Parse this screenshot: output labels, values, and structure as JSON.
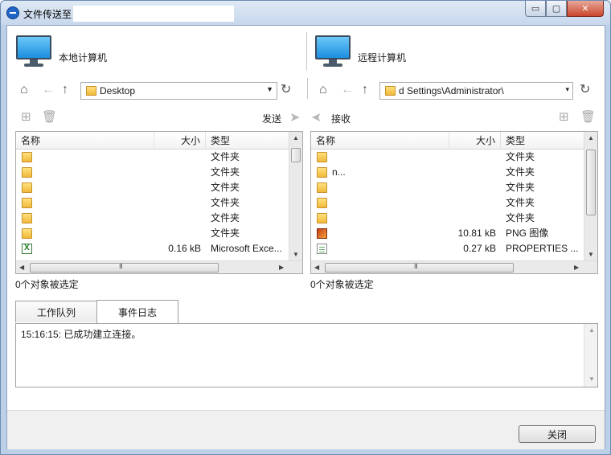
{
  "window": {
    "title": "文件传送至",
    "minimize_glyph": "▭",
    "maximize_glyph": "▢",
    "close_glyph": "✕"
  },
  "local": {
    "label": "本地计算机",
    "path": "Desktop",
    "send_label": "发送",
    "columns": {
      "name": "名称",
      "size": "大小",
      "type": "类型"
    },
    "rows": [
      {
        "icon": "folder-icon",
        "name": "",
        "size": "",
        "type": "文件夹"
      },
      {
        "icon": "folder-icon",
        "name": "",
        "size": "",
        "type": "文件夹"
      },
      {
        "icon": "folder-icon",
        "name": "",
        "size": "",
        "type": "文件夹"
      },
      {
        "icon": "folder-icon",
        "name": "",
        "size": "",
        "type": "文件夹"
      },
      {
        "icon": "folder-icon",
        "name": "",
        "size": "",
        "type": "文件夹"
      },
      {
        "icon": "folder-icon",
        "name": "",
        "size": "",
        "type": "文件夹"
      },
      {
        "icon": "excel-file-icon",
        "name": "",
        "size": "0.16 kB",
        "type": "Microsoft Exce..."
      }
    ],
    "status": "0个对象被选定"
  },
  "remote": {
    "label": "远程计算机",
    "path": "d Settings\\Administrator\\",
    "receive_label": "接收",
    "columns": {
      "name": "名称",
      "size": "大小",
      "type": "类型"
    },
    "rows": [
      {
        "icon": "folder-icon",
        "name": "",
        "size": "",
        "type": "文件夹"
      },
      {
        "icon": "folder-icon",
        "name": "n...",
        "size": "",
        "type": "文件夹"
      },
      {
        "icon": "folder-icon",
        "name": "",
        "size": "",
        "type": "文件夹"
      },
      {
        "icon": "folder-icon",
        "name": "",
        "size": "",
        "type": "文件夹"
      },
      {
        "icon": "folder-icon",
        "name": "",
        "size": "",
        "type": "文件夹"
      },
      {
        "icon": "png-file-icon",
        "name": "",
        "size": "10.81 kB",
        "type": "PNG 图像"
      },
      {
        "icon": "properties-file-icon",
        "name": "",
        "size": "0.27 kB",
        "type": "PROPERTIES ..."
      }
    ],
    "status": "0个对象被选定"
  },
  "tabs": [
    "工作队列",
    "事件日志"
  ],
  "active_tab": "事件日志",
  "log": [
    "15:16:15: 已成功建立连接。"
  ],
  "footer": {
    "close_label": "关闭"
  },
  "colors": {
    "accent": "#1f66c6",
    "folder": "#f0b93a"
  }
}
